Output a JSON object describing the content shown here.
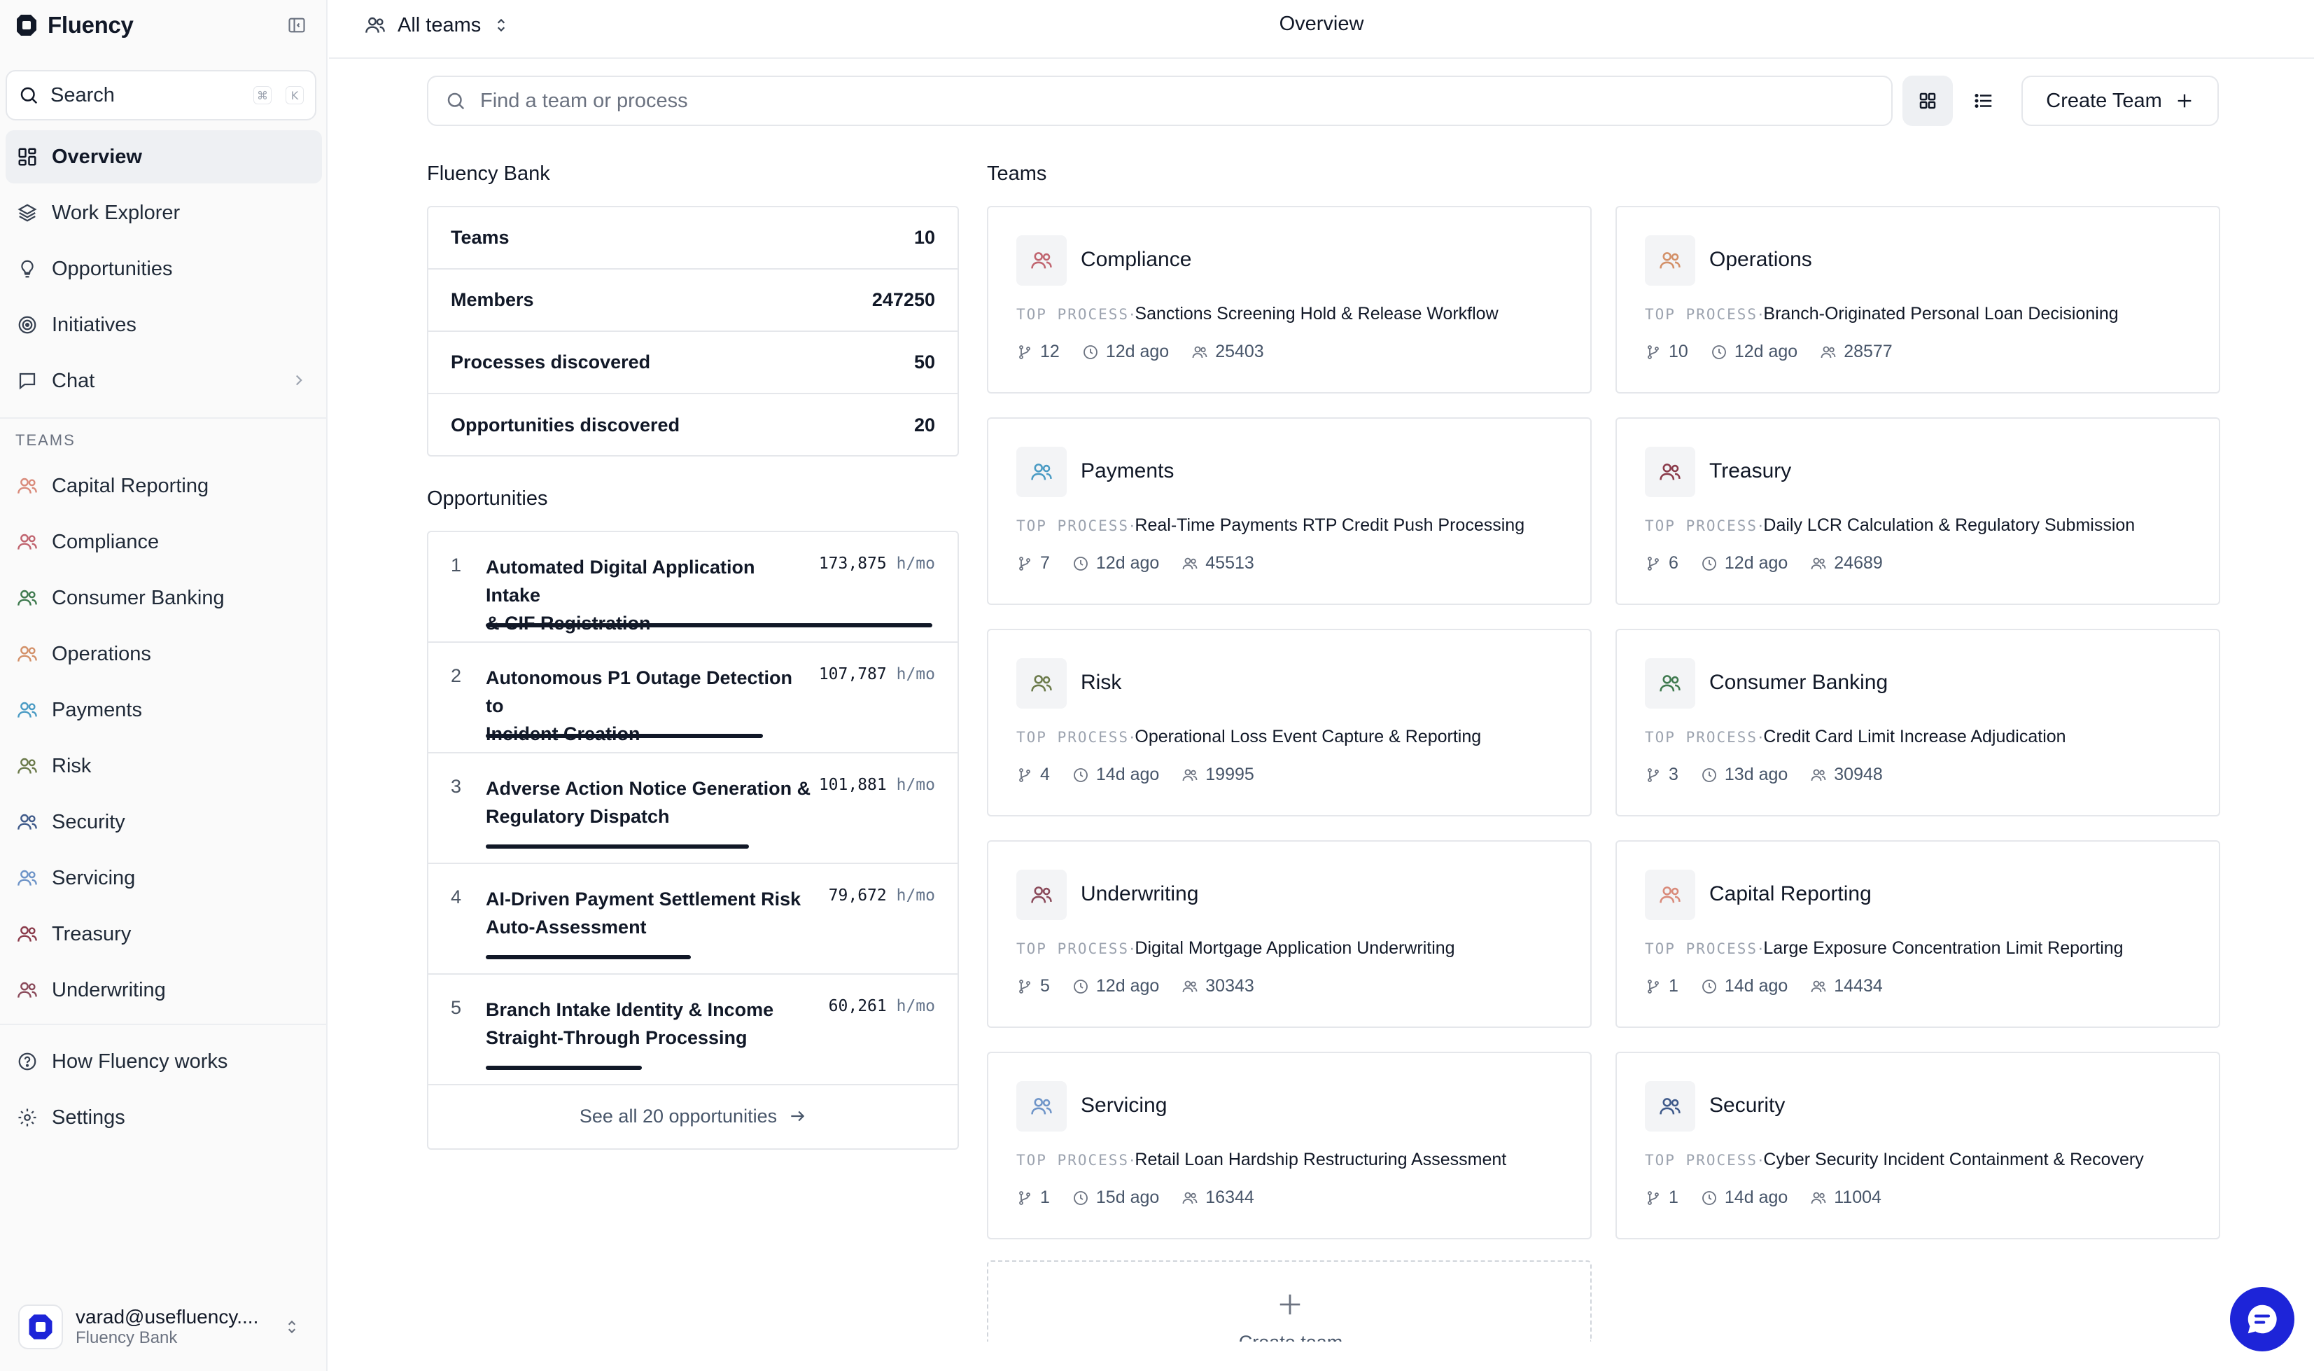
{
  "app": {
    "name": "Fluency"
  },
  "sidebar": {
    "search_label": "Search",
    "shortcut": [
      "⌘",
      "K"
    ],
    "nav": [
      {
        "label": "Overview",
        "icon": "grid-icon",
        "active": true
      },
      {
        "label": "Work Explorer",
        "icon": "layers-icon"
      },
      {
        "label": "Opportunities",
        "icon": "lightbulb-icon"
      },
      {
        "label": "Initiatives",
        "icon": "target-icon"
      },
      {
        "label": "Chat",
        "icon": "chat-icon"
      }
    ],
    "teams_section": "TEAMS",
    "teams": [
      {
        "label": "Capital Reporting",
        "color": "#d98a7a"
      },
      {
        "label": "Compliance",
        "color": "#c0646f"
      },
      {
        "label": "Consumer Banking",
        "color": "#3f7a4f"
      },
      {
        "label": "Operations",
        "color": "#d39068"
      },
      {
        "label": "Payments",
        "color": "#4a9bc4"
      },
      {
        "label": "Risk",
        "color": "#6b7a4a"
      },
      {
        "label": "Security",
        "color": "#3f5a8a"
      },
      {
        "label": "Servicing",
        "color": "#6e94c8"
      },
      {
        "label": "Treasury",
        "color": "#8a3a4a"
      },
      {
        "label": "Underwriting",
        "color": "#8a4a5a"
      }
    ],
    "footer": [
      {
        "label": "How Fluency works",
        "icon": "help-icon"
      },
      {
        "label": "Settings",
        "icon": "gear-icon"
      }
    ],
    "account": {
      "email": "varad@usefluency....",
      "org": "Fluency Bank"
    }
  },
  "header": {
    "team_switch": "All teams",
    "title": "Overview"
  },
  "toolbar": {
    "search_placeholder": "Find a team or process",
    "create_label": "Create Team"
  },
  "org": {
    "name": "Fluency Bank",
    "stats": [
      {
        "label": "Teams",
        "value": "10"
      },
      {
        "label": "Members",
        "value": "247250"
      },
      {
        "label": "Processes discovered",
        "value": "50"
      },
      {
        "label": "Opportunities discovered",
        "value": "20"
      }
    ]
  },
  "opportunities": {
    "heading": "Opportunities",
    "unit": "h/mo",
    "items": [
      {
        "rank": "1",
        "line1": "Automated Digital Application Intake",
        "line2": "& CIF Registration",
        "value": "173,875",
        "fraction": 1.0
      },
      {
        "rank": "2",
        "line1": "Autonomous P1 Outage Detection to",
        "line2": "Incident Creation",
        "value": "107,787",
        "fraction": 0.62
      },
      {
        "rank": "3",
        "line1": "Adverse Action Notice Generation &",
        "line2": "Regulatory Dispatch",
        "value": "101,881",
        "fraction": 0.59
      },
      {
        "rank": "4",
        "line1": "AI-Driven Payment Settlement Risk",
        "line2": "Auto-Assessment",
        "value": "79,672",
        "fraction": 0.46
      },
      {
        "rank": "5",
        "line1": "Branch Intake Identity & Income",
        "line2": "Straight-Through Processing",
        "value": "60,261",
        "fraction": 0.35
      }
    ],
    "see_all": "See all 20 opportunities"
  },
  "teams_panel": {
    "heading": "Teams",
    "top_process_label": "TOP PROCESS",
    "cards": [
      {
        "name": "Compliance",
        "process": "Sanctions Screening Hold & Release Workflow",
        "processes": "12",
        "updated": "12d ago",
        "members": "25403",
        "color": "#c0646f"
      },
      {
        "name": "Operations",
        "process": "Branch-Originated Personal Loan Decisioning",
        "processes": "10",
        "updated": "12d ago",
        "members": "28577",
        "color": "#d39068"
      },
      {
        "name": "Payments",
        "process": "Real-Time Payments RTP Credit Push Processing",
        "processes": "7",
        "updated": "12d ago",
        "members": "45513",
        "color": "#4a9bc4"
      },
      {
        "name": "Treasury",
        "process": "Daily LCR Calculation & Regulatory Submission",
        "processes": "6",
        "updated": "12d ago",
        "members": "24689",
        "color": "#8a3a4a"
      },
      {
        "name": "Risk",
        "process": "Operational Loss Event Capture & Reporting",
        "processes": "4",
        "updated": "14d ago",
        "members": "19995",
        "color": "#6b7a4a"
      },
      {
        "name": "Consumer Banking",
        "process": "Credit Card Limit Increase Adjudication",
        "processes": "3",
        "updated": "13d ago",
        "members": "30948",
        "color": "#3f7a4f"
      },
      {
        "name": "Underwriting",
        "process": "Digital Mortgage Application Underwriting",
        "processes": "5",
        "updated": "12d ago",
        "members": "30343",
        "color": "#8a4a5a"
      },
      {
        "name": "Capital Reporting",
        "process": "Large Exposure Concentration Limit Reporting",
        "processes": "1",
        "updated": "14d ago",
        "members": "14434",
        "color": "#d98a7a"
      },
      {
        "name": "Servicing",
        "process": "Retail Loan Hardship Restructuring Assessment",
        "processes": "1",
        "updated": "15d ago",
        "members": "16344",
        "color": "#6e94c8"
      },
      {
        "name": "Security",
        "process": "Cyber Security Incident Containment & Recovery",
        "processes": "1",
        "updated": "14d ago",
        "members": "11004",
        "color": "#3f5a8a"
      }
    ],
    "add_label": "Create team"
  },
  "colors": {
    "accent": "#1d24d8",
    "border": "#e5e7eb",
    "muted": "#6b7280"
  }
}
